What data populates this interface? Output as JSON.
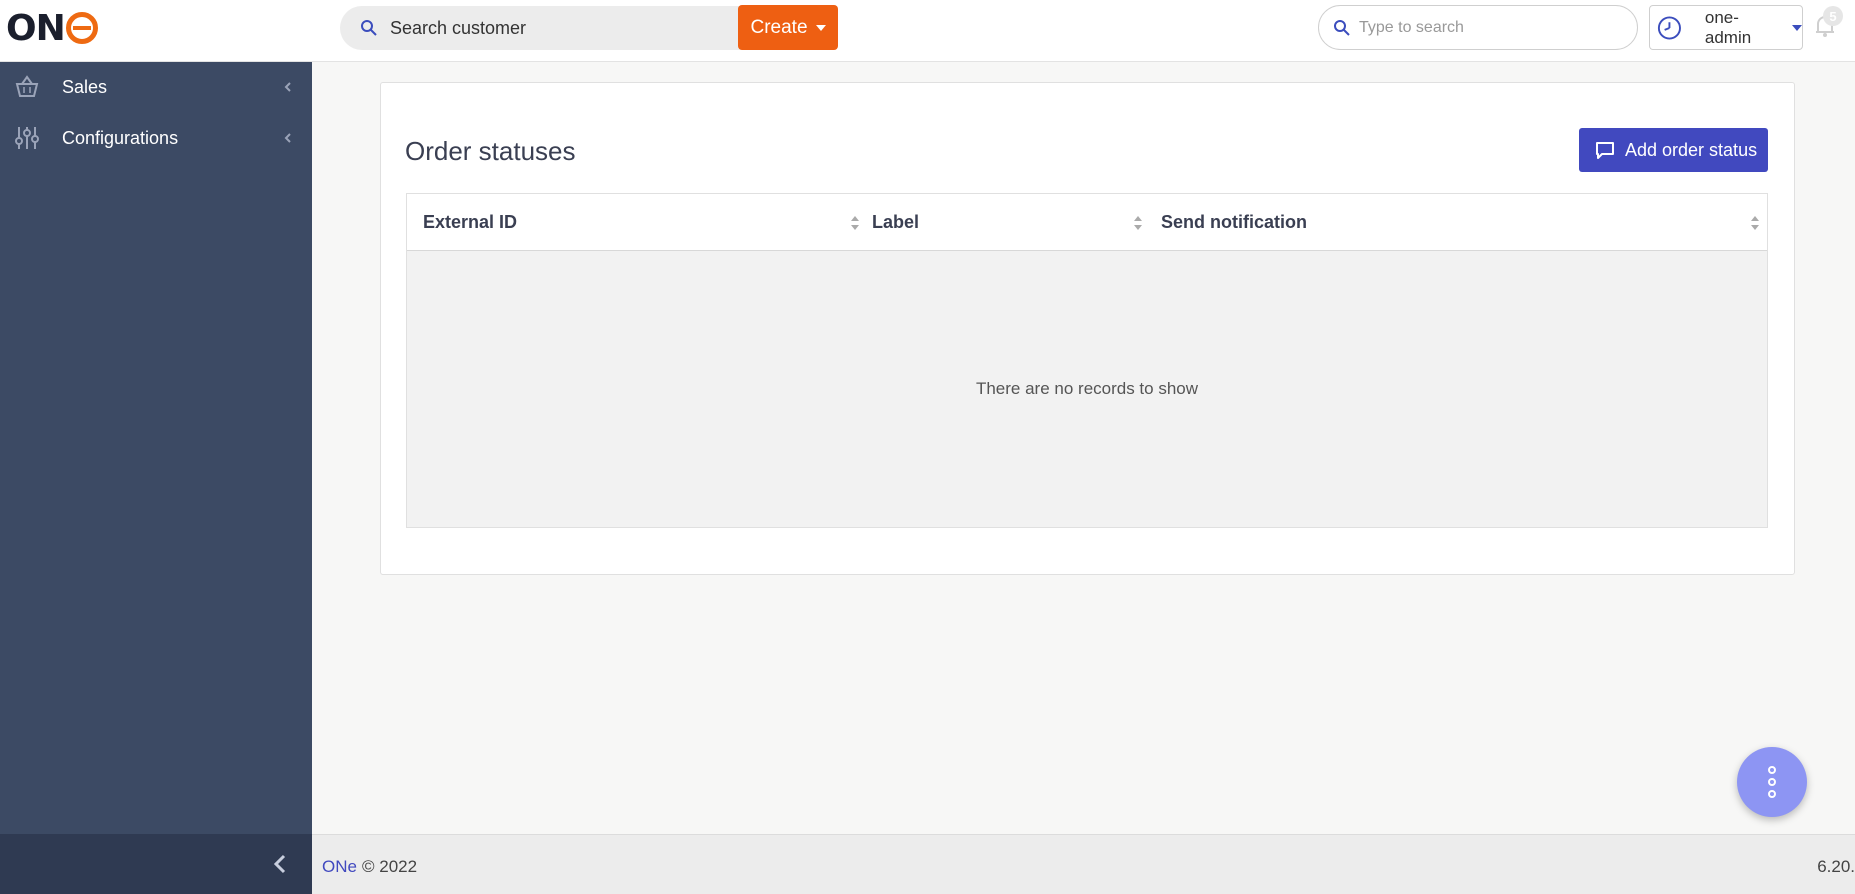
{
  "header": {
    "logo": "ONe",
    "customer_search_text": "Search customer",
    "create_label": "Create",
    "global_search_placeholder": "Type to search",
    "user_name": "one-admin",
    "notification_count": "5"
  },
  "sidebar": {
    "items": [
      {
        "label": "Sales",
        "icon": "basket-icon"
      },
      {
        "label": "Configurations",
        "icon": "sliders-icon"
      }
    ]
  },
  "main": {
    "title": "Order statuses",
    "add_button_label": "Add order status",
    "table": {
      "columns": [
        "External ID",
        "Label",
        "Send notification"
      ],
      "empty_text": "There are no records to show"
    }
  },
  "footer": {
    "brand": "ONe",
    "copyright": "© 2022",
    "version": "6.20."
  },
  "colors": {
    "accent": "#4149bf",
    "create": "#ee5f12",
    "sidebar": "#3c4a64"
  }
}
